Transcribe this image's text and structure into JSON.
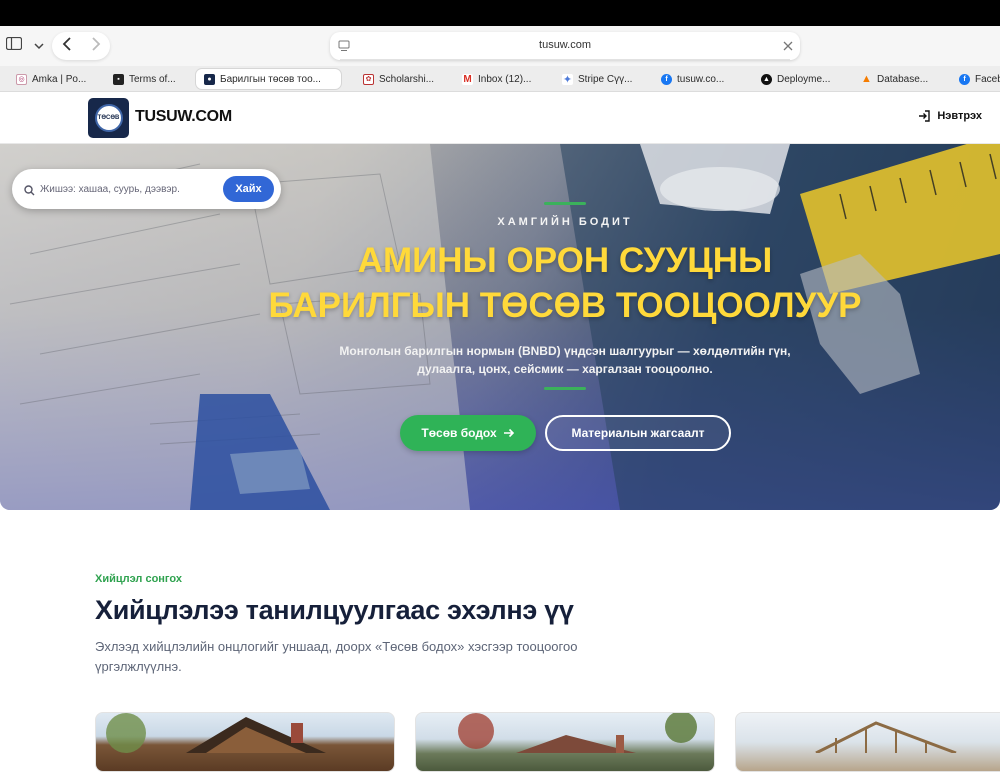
{
  "browser": {
    "url": "tusuw.com",
    "tabs": [
      {
        "label": "Amka | Po...",
        "icon": "amka-favicon"
      },
      {
        "label": "Terms of...",
        "icon": "terms-favicon"
      },
      {
        "label": "Барилгын төсөв тоо...",
        "icon": "tusuw-favicon",
        "active": true
      },
      {
        "label": "Scholarshi...",
        "icon": "scholarship-favicon"
      },
      {
        "label": "Inbox (12)...",
        "icon": "gmail-favicon"
      },
      {
        "label": "Stripe Сүү...",
        "icon": "stripe-favicon"
      },
      {
        "label": "tusuw.co...",
        "icon": "facebook-favicon"
      },
      {
        "label": "Deployme...",
        "icon": "vercel-favicon"
      },
      {
        "label": "Database...",
        "icon": "firebase-favicon"
      },
      {
        "label": "Facebo",
        "icon": "facebook-favicon"
      }
    ]
  },
  "header": {
    "logo_text": "TӨСӨВ",
    "brand": "TUSUW.COM",
    "login_label": "Нэвтрэх"
  },
  "hero": {
    "search_placeholder": "Жишээ: хашаа, суурь, дээвэр.",
    "search_button": "Хайх",
    "eyebrow": "ХАМГИЙН БОДИТ",
    "title_line1": "АМИНЫ ОРОН СУУЦНЫ",
    "title_line2": "БАРИЛГЫН ТӨСӨВ ТООЦООЛУУР",
    "subtitle": "Монголын барилгын нормын (BNBD) үндсэн шалгуурыг — хөлдөлтийн гүн, дулаалга, цонх, сейсмик — харгалзан тооцоолно.",
    "cta_primary": "Төсөв бодох",
    "cta_secondary": "Материалын жагсаалт"
  },
  "section": {
    "eyebrow": "Хийцлэл сонгох",
    "title": "Хийцлэлээ танилцуулгаас эхэлнэ үү",
    "description": "Эхлээд хийцлэлийн онцлогийг уншаад, доорх «Төсөв бодох» хэсгээр тооцоогоо үргэлжлүүлнэ."
  },
  "colors": {
    "accent_green": "#2fb357",
    "title_yellow": "#ffd93a",
    "primary_blue": "#3167d6",
    "navy": "#16203a"
  }
}
